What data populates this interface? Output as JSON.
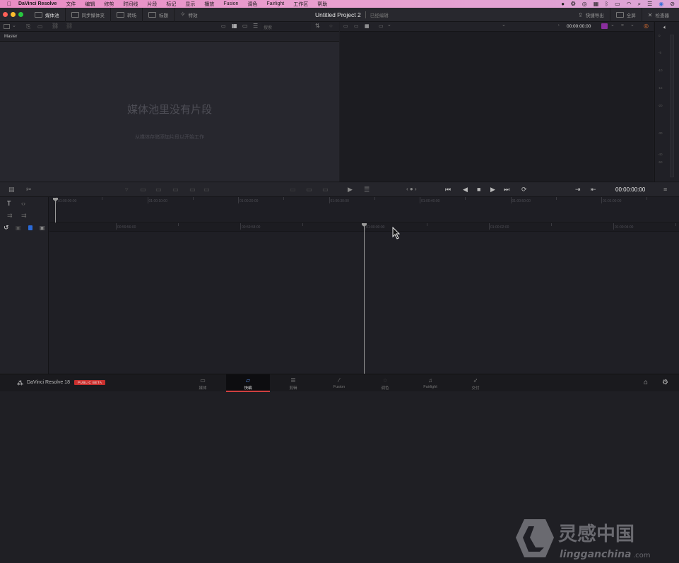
{
  "menubar": {
    "apple": "",
    "app_name": "DaVinci Resolve",
    "items": [
      "文件",
      "编辑",
      "修剪",
      "时间线",
      "片段",
      "标记",
      "显示",
      "播放",
      "Fusion",
      "调色",
      "Fairlight",
      "工作区",
      "帮助"
    ],
    "status_icons": [
      "record-icon",
      "creative-cloud-icon",
      "cc-icon",
      "calendar-icon",
      "bluetooth-icon",
      "battery-icon",
      "wifi-icon",
      "spotlight-icon",
      "control-center-icon",
      "siri-icon",
      "screen-time-icon"
    ]
  },
  "app_toolbar": {
    "left_buttons": [
      {
        "label": "媒体池",
        "icon": "media-pool-icon",
        "active": true
      },
      {
        "label": "同步媒体夹",
        "icon": "sync-bin-icon",
        "active": false
      },
      {
        "label": "转场",
        "icon": "transitions-icon",
        "active": false
      },
      {
        "label": "标题",
        "icon": "titles-icon",
        "active": false
      },
      {
        "label": "特效",
        "icon": "effects-icon",
        "active": false
      }
    ],
    "project_title": "Untitled Project 2",
    "project_status": "已经编辑",
    "right_buttons": [
      {
        "label": "快捷导出",
        "icon": "quick-export-icon"
      },
      {
        "label": "全屏",
        "icon": "fullscreen-icon"
      },
      {
        "label": "检查器",
        "icon": "inspector-icon"
      }
    ]
  },
  "media_pool": {
    "search_placeholder": "搜索",
    "bin_name": "Master",
    "empty_title": "媒体池里没有片段",
    "empty_subtitle": "从媒体存储添加片段以开始工作"
  },
  "viewer": {
    "timecode": "00:00:00:00",
    "transport_timecode": "00:00:00:00"
  },
  "audio_meter": {
    "scale": [
      "0",
      "-5",
      "-10",
      "-15",
      "-20",
      "-30",
      "-40",
      "-50"
    ]
  },
  "timeline": {
    "upper_ruler": [
      "01:00:00:00",
      "01:00:10:00",
      "01:00:20:00",
      "01:00:30:00",
      "01:00:40:00",
      "01:00:50:00",
      "01:01:00:00"
    ],
    "lower_ruler": [
      "00:59:56:00",
      "00:59:58:00",
      "01:00:00:00",
      "01:00:02:00",
      "01:00:04:00"
    ]
  },
  "bottom_bar": {
    "app_label": "DaVinci Resolve 18",
    "badge": "PUBLIC BETA",
    "badge_color": "#c8302e",
    "pages": [
      {
        "label": "媒体",
        "icon": "media-page-icon",
        "active": false
      },
      {
        "label": "快编",
        "icon": "cut-page-icon",
        "active": true
      },
      {
        "label": "剪辑",
        "icon": "edit-page-icon",
        "active": false
      },
      {
        "label": "Fusion",
        "icon": "fusion-page-icon",
        "active": false
      },
      {
        "label": "调色",
        "icon": "color-page-icon",
        "active": false
      },
      {
        "label": "Fairlight",
        "icon": "fairlight-page-icon",
        "active": false
      },
      {
        "label": "交付",
        "icon": "deliver-page-icon",
        "active": false
      }
    ]
  },
  "watermark": {
    "title": "灵感中国",
    "url": "lingganchina",
    "tld": ".com"
  }
}
